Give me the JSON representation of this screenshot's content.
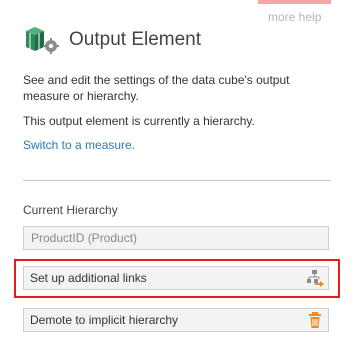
{
  "help": {
    "more_help_label": "more help"
  },
  "header": {
    "title": "Output Element",
    "icon": "cube-gear-icon"
  },
  "description": {
    "line1": "See and edit the settings of the data cube's output measure or hierarchy.",
    "line2": "This output element is currently a hierarchy.",
    "switch_link": "Switch to a measure."
  },
  "current": {
    "label": "Current Hierarchy",
    "value": "ProductID (Product)"
  },
  "actions": {
    "links_label": "Set up additional links",
    "links_icon": "hierarchy-link-icon",
    "demote_label": "Demote to implicit hierarchy",
    "demote_icon": "trash-icon"
  },
  "colors": {
    "accent_link": "#2a7ab8",
    "highlight": "#e31b1b",
    "cube_green": "#2f8a5a",
    "arrow_orange": "#f08a24"
  }
}
